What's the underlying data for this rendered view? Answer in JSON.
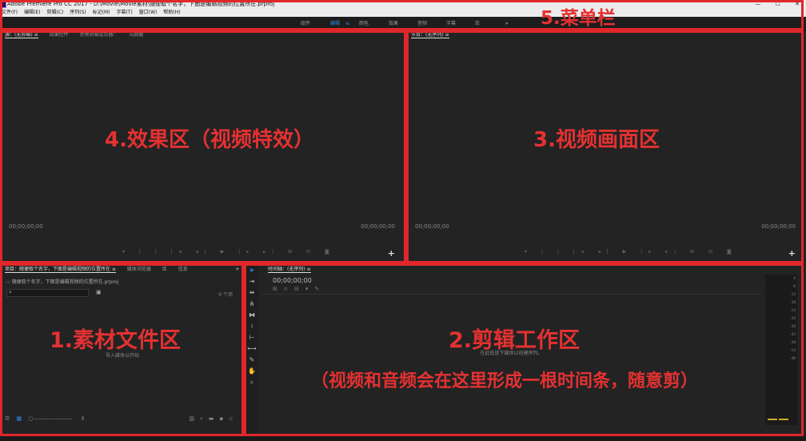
{
  "titlebar": {
    "title": "Adobe Premiere Pro CC 2017 - D:\\Movie\\Movie素材\\随便取个名字，下面是编辑视频的位置所在.prproj",
    "min": "—",
    "max": "☐",
    "close": "✕"
  },
  "menu": [
    "文件(F)",
    "编辑(E)",
    "剪辑(C)",
    "序列(S)",
    "标记(M)",
    "字幕(T)",
    "窗口(W)",
    "帮助(H)"
  ],
  "workspaces": {
    "items": [
      "组件",
      "编辑",
      "颜色",
      "效果",
      "音频",
      "字幕",
      "库"
    ],
    "active": "编辑",
    "edit_menu_icon": "≡",
    "more": "»"
  },
  "source_panel": {
    "tabs": [
      "源：(无剪辑) ≡",
      "效果控件",
      "音频剪辑混合器：",
      "元数据"
    ],
    "timecode_left": "00;00;00;00",
    "timecode_right": "00;00;00;00",
    "controls": "▾ | | |◂ ◂| ▶ |▸ ▸| ⊞ ⊟ ◙",
    "plus": "+"
  },
  "program_panel": {
    "tab": "节目：(无序列) ≡",
    "timecode_left": "00;00;00;00",
    "timecode_right": "00;00;00;00",
    "controls": "▾ | | |◂ ◂| ▶ |▸ ▸| ⊞ ⊟ ◙",
    "plus": "+"
  },
  "project_panel": {
    "tabs": [
      "项目：随便取个名字，下面是编辑视频的位置所在 ≡",
      "媒体浏览器",
      "库",
      "信息"
    ],
    "more": "»",
    "path": "随便取个名字，下面是编辑视频的位置所在.prproj",
    "search_placeholder": "",
    "items_count": "0 个项",
    "empty_hint": "导入媒体以开始"
  },
  "timeline_panel": {
    "tab": "时间轴：(无序列) ≡",
    "timecode": "00;00;00;00",
    "empty_hint": "在此处放下媒体以创建序列。"
  },
  "audio_meter": {
    "ticks": [
      "0",
      "-6",
      "-12",
      "-18",
      "-24",
      "-30",
      "-36",
      "-42",
      "-48",
      "-54",
      "-dB"
    ]
  },
  "annotations": {
    "menu_bar": "5.菜单栏",
    "effects_area": "4.效果区（视频特效）",
    "video_area": "3.视频画面区",
    "media_area": "1.素材文件区",
    "edit_area": "2.剪辑工作区",
    "edit_note": "（视频和音频会在这里形成一根时间条，随意剪）"
  },
  "colors": {
    "annotation_red": "#e0272b",
    "workspace_active": "#2d8ceb"
  }
}
